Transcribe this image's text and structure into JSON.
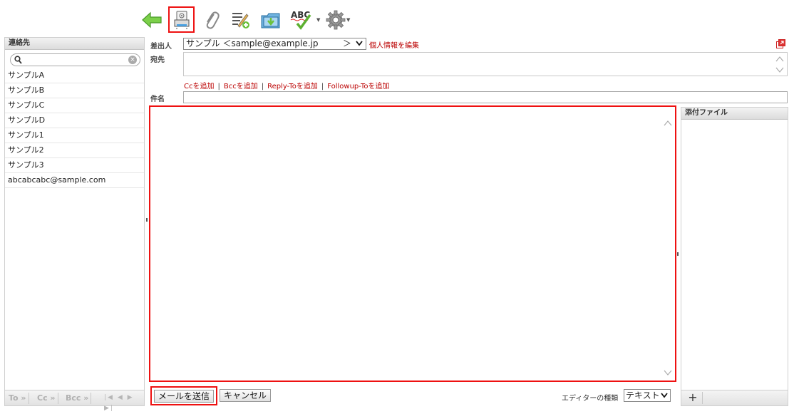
{
  "toolbar": {
    "buttons": [
      {
        "name": "back",
        "icon": "back-arrow-icon"
      },
      {
        "name": "save-draft",
        "icon": "save-draft-icon",
        "highlighted": true
      },
      {
        "name": "attach",
        "icon": "paperclip-icon"
      },
      {
        "name": "signature",
        "icon": "signature-icon"
      },
      {
        "name": "import",
        "icon": "import-icon"
      },
      {
        "name": "spellcheck",
        "icon": "spellcheck-icon",
        "label": "ABC"
      },
      {
        "name": "settings",
        "icon": "gear-icon"
      }
    ]
  },
  "contacts": {
    "title": "連絡先",
    "search_placeholder": "",
    "items": [
      "サンプルA",
      "サンプルB",
      "サンプルC",
      "サンプルD",
      "サンプル1",
      "サンプル2",
      "サンプル3",
      "abcabcabc@sample.com"
    ],
    "footer": {
      "to": "To »",
      "cc": "Cc »",
      "bcc": "Bcc »",
      "nav": "|◀ ◀ ▶ ▶|"
    }
  },
  "compose": {
    "from_label": "差出人",
    "from_value": "サンプル ＜sample@example.jp",
    "from_gt": "＞",
    "edit_profile": "個人情報を編集",
    "to_label": "宛先",
    "to_value": "",
    "add_cc": "Ccを追加",
    "add_bcc": "Bccを追加",
    "add_reply_to": "Reply-Toを追加",
    "add_followup_to": "Followup-Toを追加",
    "separator": "|",
    "subject_label": "件名",
    "subject_value": "",
    "body_value": ""
  },
  "attachments": {
    "title": "添付ファイル",
    "add_label": "+"
  },
  "bottom": {
    "send": "メールを送信",
    "cancel": "キャンセル",
    "editor_type_label": "エディターの種類",
    "editor_type_value": "テキスト"
  },
  "colors": {
    "highlight": "#ee1111",
    "link": "#bb0000",
    "accent_green": "#6cc13c"
  }
}
